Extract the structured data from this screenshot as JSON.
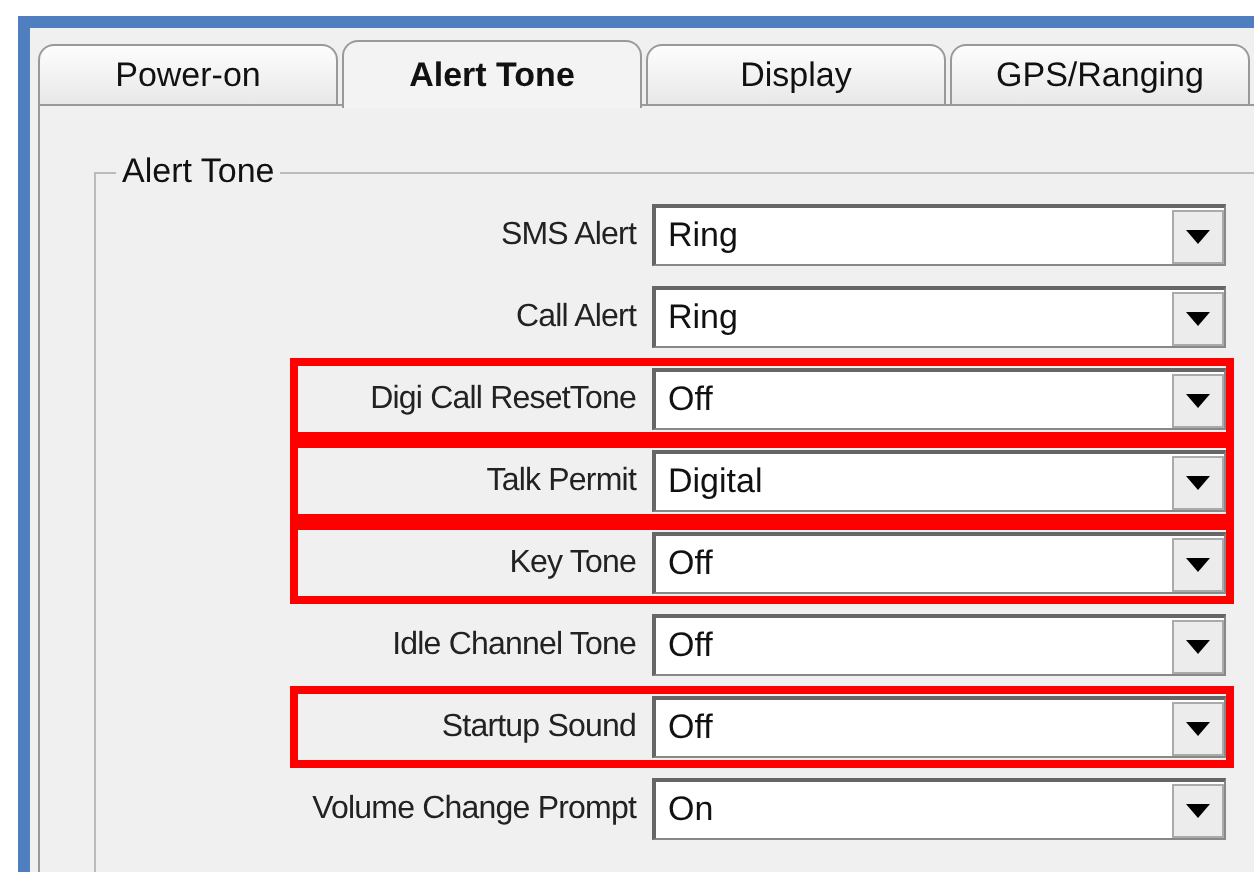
{
  "tabs": [
    {
      "label": "Power-on",
      "selected": false
    },
    {
      "label": "Alert Tone",
      "selected": true
    },
    {
      "label": "Display",
      "selected": false
    },
    {
      "label": "GPS/Ranging",
      "selected": false
    }
  ],
  "group": {
    "title": "Alert Tone"
  },
  "settings": [
    {
      "label": "SMS Alert",
      "value": "Ring",
      "highlighted": false
    },
    {
      "label": "Call Alert",
      "value": "Ring",
      "highlighted": false
    },
    {
      "label": "Digi Call ResetTone",
      "value": "Off",
      "highlighted": true
    },
    {
      "label": "Talk Permit",
      "value": "Digital",
      "highlighted": true
    },
    {
      "label": "Key Tone",
      "value": "Off",
      "highlighted": true
    },
    {
      "label": "Idle Channel Tone",
      "value": "Off",
      "highlighted": false
    },
    {
      "label": "Startup Sound",
      "value": "Off",
      "highlighted": true
    },
    {
      "label": "Volume Change Prompt",
      "value": "On",
      "highlighted": false
    }
  ]
}
